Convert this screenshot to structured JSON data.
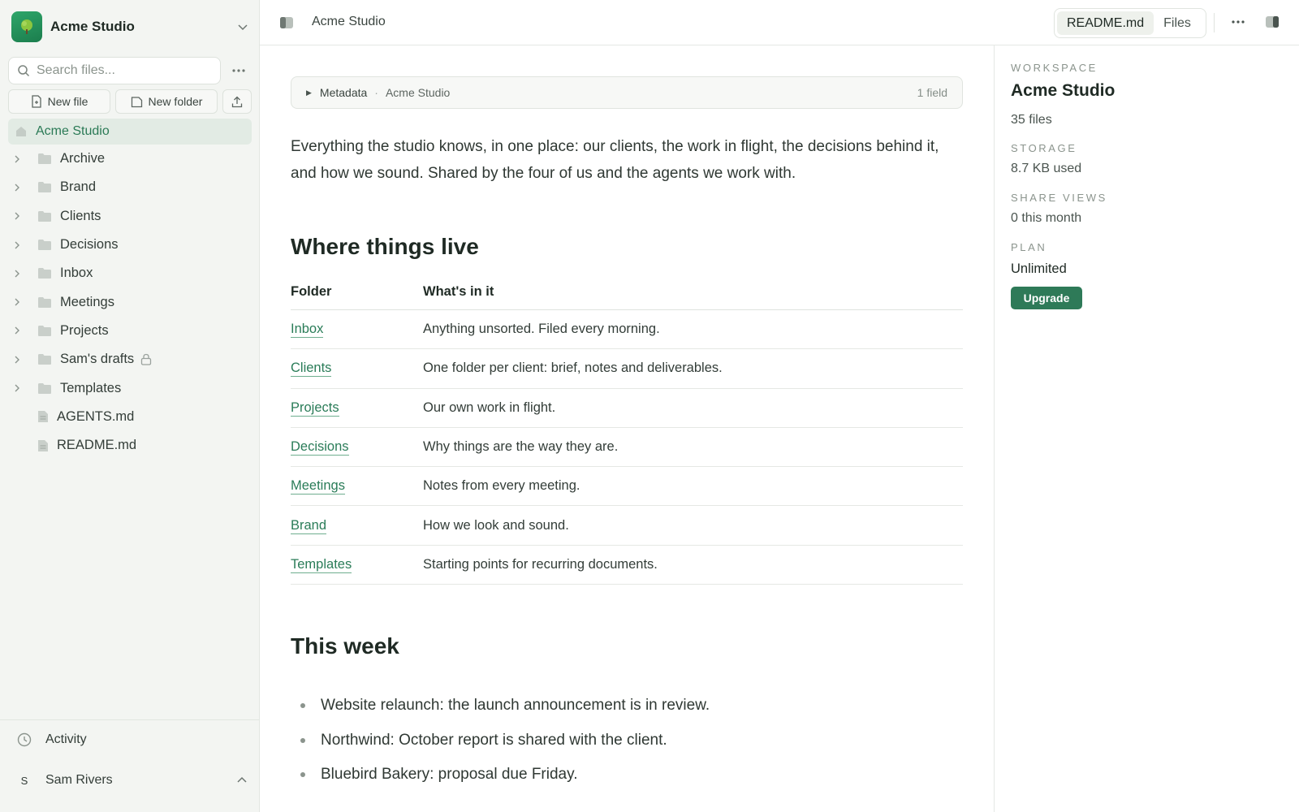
{
  "workspace": {
    "name": "Acme Studio"
  },
  "sidebar": {
    "search_placeholder": "Search files...",
    "actions": {
      "new_file": "New file",
      "new_folder": "New folder"
    },
    "root_label": "Acme Studio",
    "folders": [
      {
        "label": "Archive",
        "icon": "folder-icon"
      },
      {
        "label": "Brand",
        "icon": "folder-icon"
      },
      {
        "label": "Clients",
        "icon": "folder-icon"
      },
      {
        "label": "Decisions",
        "icon": "folder-icon"
      },
      {
        "label": "Inbox",
        "icon": "folder-icon"
      },
      {
        "label": "Meetings",
        "icon": "folder-icon"
      },
      {
        "label": "Projects",
        "icon": "folder-icon"
      },
      {
        "label": "Sam's drafts",
        "icon": "folder-icon",
        "locked": true
      },
      {
        "label": "Templates",
        "icon": "folder-icon"
      }
    ],
    "files": [
      {
        "label": "AGENTS.md",
        "icon": "file-icon"
      },
      {
        "label": "README.md",
        "icon": "file-icon"
      }
    ],
    "activity_label": "Activity",
    "user": {
      "initial": "S",
      "name": "Sam Rivers"
    }
  },
  "topbar": {
    "title": "Acme Studio",
    "tabs": [
      {
        "label": "README.md",
        "active": true
      },
      {
        "label": "Files",
        "active": false
      }
    ]
  },
  "document": {
    "metadata": {
      "label": "Metadata",
      "value": "Acme Studio",
      "count": "1 field"
    },
    "intro": "Everything the studio knows, in one place: our clients, the work in flight, the decisions behind it, and how we sound. Shared by the four of us and the agents we work with.",
    "section1_title": "Where things live",
    "table": {
      "headers": [
        "Folder",
        "What's in it"
      ],
      "rows": [
        {
          "folder": "Inbox",
          "desc": "Anything unsorted. Filed every morning."
        },
        {
          "folder": "Clients",
          "desc": "One folder per client: brief, notes and deliverables."
        },
        {
          "folder": "Projects",
          "desc": "Our own work in flight."
        },
        {
          "folder": "Decisions",
          "desc": "Why things are the way they are."
        },
        {
          "folder": "Meetings",
          "desc": "Notes from every meeting."
        },
        {
          "folder": "Brand",
          "desc": "How we look and sound."
        },
        {
          "folder": "Templates",
          "desc": "Starting points for recurring documents."
        }
      ]
    },
    "section2_title": "This week",
    "week_items": [
      "Website relaunch: the launch announcement is in review.",
      "Northwind: October report is shared with the client.",
      "Bluebird Bakery: proposal due Friday."
    ]
  },
  "details": {
    "workspace_label": "WORKSPACE",
    "workspace_name": "Acme Studio",
    "files_count": "35 files",
    "storage_label": "STORAGE",
    "storage_value": "8.7 KB used",
    "share_label": "SHARE VIEWS",
    "share_value": "0 this month",
    "plan_label": "PLAN",
    "plan_value": "Unlimited",
    "upgrade_label": "Upgrade"
  },
  "colors": {
    "accent": "#2e7a58",
    "sidebar_bg": "#f3f5f2",
    "link": "#2a7c58"
  }
}
